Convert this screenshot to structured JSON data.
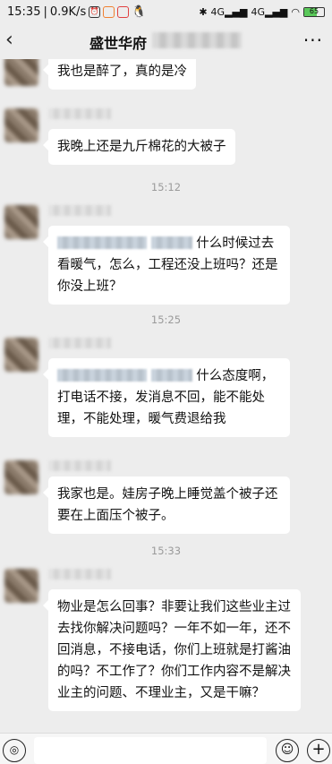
{
  "status_bar": {
    "time": "15:35",
    "network_speed": "0.9K/s",
    "signal1": "4G",
    "signal2": "4G",
    "battery": "65"
  },
  "header": {
    "title": "盛世华府",
    "back_icon": "‹",
    "more_icon": "···"
  },
  "messages": [
    {
      "text": "我也是醉了，真的是冷"
    },
    {
      "text": "我晚上还是九斤棉花的大被子"
    },
    {
      "timestamp": "15:12"
    },
    {
      "text_after_mention": "什么时候",
      "text_rest": "过去看暖气，怎么，工程还没上班吗？还是你没上班？"
    },
    {
      "timestamp": "15:25"
    },
    {
      "text_after_mention": "什么态度",
      "text_rest": "啊，打电话不接，发消息不回，能不能处理，不能处理，暖气费退给我"
    },
    {
      "text": "我家也是。娃房子晚上睡觉盖个被子还要在上面压个被子。"
    },
    {
      "timestamp": "15:33"
    },
    {
      "text": "物业是怎么回事？非要让我们这些业主过去找你解决问题吗？一年不如一年，还不回消息，不接电话，你们上班就是打酱油的吗？不工作了？你们工作内容不是解决业主的问题、不理业主，又是干嘛？"
    }
  ],
  "input_bar": {
    "voice_icon": "voice-icon",
    "emoji_icon": "emoji-icon",
    "plus_icon": "plus-icon"
  }
}
